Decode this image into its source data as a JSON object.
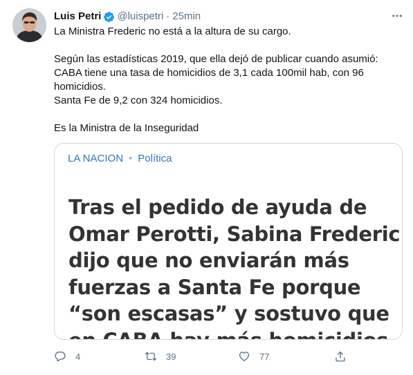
{
  "author": {
    "name": "Luis Petri",
    "handle": "@luispetri",
    "separator": "·",
    "time": "25min"
  },
  "tweet": {
    "lines": [
      "La Ministra Frederic no está a la altura de su cargo.",
      "Según las estadísticas 2019, que ella dejó de publicar cuando asumió:",
      "CABA tiene una tasa de homicidios de 3,1 cada 100mil hab, con 96 homicidios.",
      "Santa Fe de 9,2 con 324 homicidios.",
      "Es la Ministra de la Inseguridad"
    ]
  },
  "card": {
    "source": "LA NACION",
    "separator": "•",
    "section": "Política",
    "headline": "Tras el pedido de ayuda de Omar Perotti, Sabina Frederic dijo que no enviarán más fuerzas a Santa Fe porque “son escasas” y sostuvo que en CABA hay más homicidios"
  },
  "actions": {
    "reply_count": "4",
    "retweet_count": "39",
    "like_count": "77"
  },
  "icons": {
    "verified": "verified-badge-icon",
    "more": "more-options-icon",
    "reply": "reply-icon",
    "retweet": "retweet-icon",
    "like": "heart-icon",
    "share": "share-icon"
  },
  "colors": {
    "text": "#0f1419",
    "secondary": "#5b7083",
    "verified": "#1d9bf0",
    "card_source": "#2e77b8",
    "card_border": "#cfd9de"
  }
}
